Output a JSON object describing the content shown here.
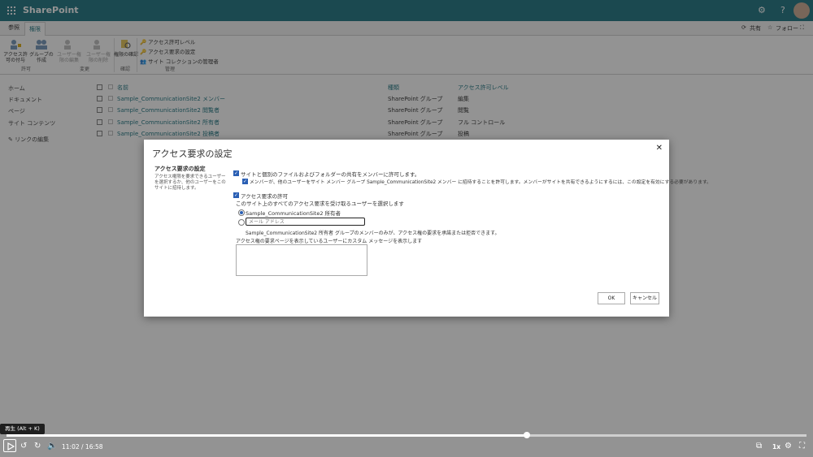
{
  "suite": {
    "brand": "SharePoint",
    "help": "?"
  },
  "ribbon_tabs": {
    "browse": "参照",
    "permissions": "権限",
    "share": "共有",
    "follow": "フォロー"
  },
  "ribbon": {
    "buttons": [
      {
        "label": "アクセス許可の付与"
      },
      {
        "label": "グループの作成"
      },
      {
        "label": "ユーザー権限の編集"
      },
      {
        "label": "ユーザー権限の削除"
      },
      {
        "label": "権限の確認"
      }
    ],
    "items": [
      "アクセス許可レベル",
      "アクセス要求の設定",
      "サイト コレクションの管理者"
    ],
    "groups": [
      "許可",
      "変更",
      "確認",
      "管理"
    ]
  },
  "nav": [
    "ホーム",
    "ドキュメント",
    "ページ",
    "サイト コンテンツ",
    "リンクの編集"
  ],
  "table": {
    "headers": {
      "name": "名前",
      "type": "種類",
      "perm": "アクセス許可レベル"
    },
    "rows": [
      {
        "name": "Sample_CommunicationSite2 メンバー",
        "type": "SharePoint グループ",
        "perm": "編集"
      },
      {
        "name": "Sample_CommunicationSite2 閲覧者",
        "type": "SharePoint グループ",
        "perm": "閲覧"
      },
      {
        "name": "Sample_CommunicationSite2 所有者",
        "type": "SharePoint グループ",
        "perm": "フル コントロール"
      },
      {
        "name": "Sample_CommunicationSite2 投稿者",
        "type": "SharePoint グループ",
        "perm": "投稿"
      }
    ]
  },
  "dialog": {
    "title": "アクセス要求の設定",
    "close": "✕",
    "section_title": "アクセス要求の設定",
    "section_desc": "アクセス権限を要求できるユーザーを選択するか、他のユーザーをこのサイトに招待します。",
    "opt1": "サイトと個別のファイルおよびフォルダーの共有をメンバーに許可します。",
    "opt1_sub": "メンバーが、他のユーザーをサイト メンバー グループ Sample_CommunicationSite2 メンバー に招待することを許可します。メンバーがサイトを共有できるようにするには、この設定を有効にする必要があります。",
    "opt2": "アクセス要求の許可",
    "opt2_desc": "このサイト上のすべてのアクセス要求を受け取るユーザーを選択します",
    "radio_owner": "Sample_CommunicationSite2 所有者",
    "email_placeholder": "メール アドレス",
    "owner_note": "Sample_CommunicationSite2 所有者 グループのメンバーのみが、アクセス権の要求を承諾または拒否できます。",
    "custom_msg_label": "アクセス権の要求ページを表示しているユーザーにカスタム メッセージを表示します",
    "ok": "OK",
    "cancel": "キャンセル"
  },
  "player": {
    "tooltip": "再生 (Alt + K)",
    "current": "11:02",
    "total": "16:58",
    "progress": 0.65,
    "rate": "1x"
  },
  "colors": {
    "suite": "#0f6b78",
    "accent": "#2a5fb4"
  }
}
